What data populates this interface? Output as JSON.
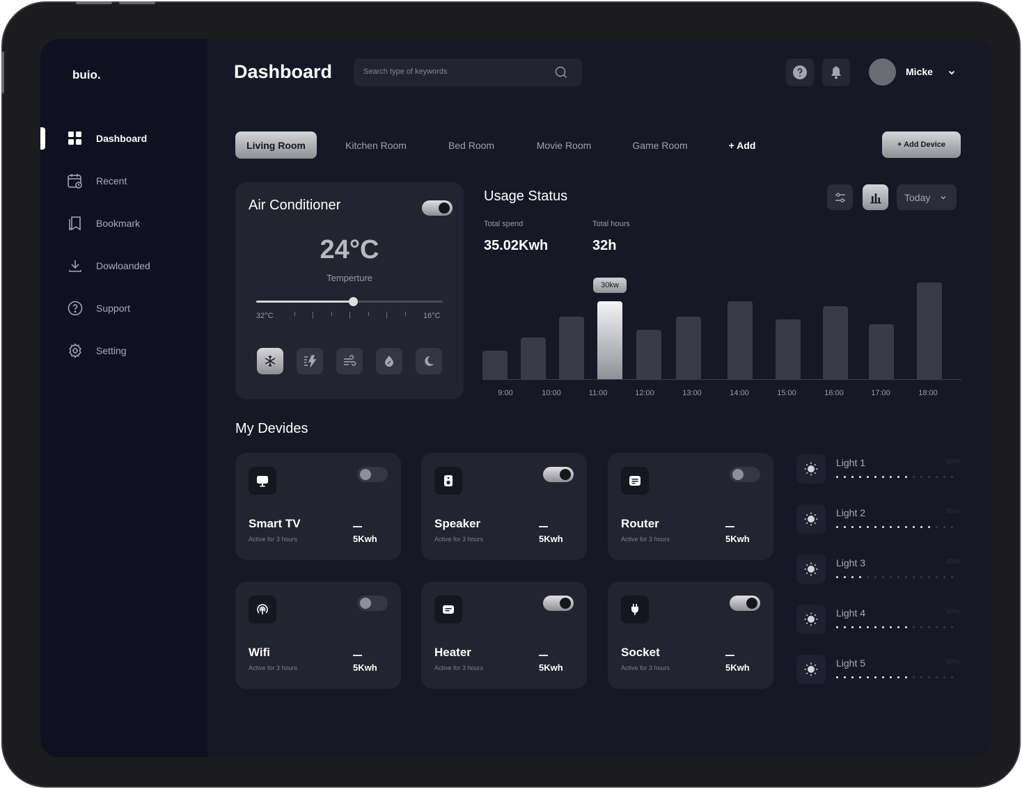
{
  "app": {
    "logo": "buio.",
    "page_title": "Dashboard"
  },
  "search": {
    "placeholder": "Search type of keywords"
  },
  "user": {
    "name": "Micke"
  },
  "sidebar": {
    "items": [
      {
        "label": "Dashboard",
        "icon": "dashboard-grid-icon",
        "active": true
      },
      {
        "label": "Recent",
        "icon": "calendar-clock-icon",
        "active": false
      },
      {
        "label": "Bookmark",
        "icon": "bookmark-icon",
        "active": false
      },
      {
        "label": "Dowloanded",
        "icon": "download-icon",
        "active": false
      },
      {
        "label": "Support",
        "icon": "help-circle-icon",
        "active": false
      },
      {
        "label": "Setting",
        "icon": "gear-icon",
        "active": false
      }
    ]
  },
  "rooms": {
    "tabs": [
      "Living Room",
      "Kitchen Room",
      "Bed Room",
      "Movie Room",
      "Game Room"
    ],
    "add_label": "+ Add",
    "active_index": 0
  },
  "add_device_label": "+ Add Device",
  "air_conditioner": {
    "title": "Air Conditioner",
    "power_on": true,
    "temperature": "24°C",
    "temperature_label": "Temperture",
    "scale_min": "32°C",
    "scale_max": "16°C",
    "slider_level": 0.52,
    "modes": [
      "snowflake-icon",
      "energy-bolt-icon",
      "wind-icon",
      "drop-icon",
      "moon-icon"
    ],
    "active_mode_index": 0
  },
  "usage": {
    "title": "Usage Status",
    "total_spend_label": "Total spend",
    "total_spend": "35.02Kwh",
    "total_hours_label": "Total hours",
    "total_hours": "32h",
    "period": "Today",
    "tooltip": "30kw"
  },
  "chart_data": {
    "type": "bar",
    "categories": [
      "9:00",
      "",
      "10:00",
      "",
      "11:00",
      "",
      "12:00",
      "",
      "13:00",
      "",
      "14:00",
      "",
      "15:00",
      "",
      "16:00",
      "",
      "17:00",
      "",
      "18:00"
    ],
    "x_tick_labels": [
      "9:00",
      "10:00",
      "11:00",
      "12:00",
      "13:00",
      "14:00",
      "15:00",
      "16:00",
      "17:00",
      "18:00"
    ],
    "values": [
      11,
      16,
      24,
      30,
      19,
      24,
      30,
      23,
      28,
      21,
      37
    ],
    "bar_labels_positions": [
      "9:00",
      "9:30",
      "10:00",
      "11:00",
      "12:00",
      "13:00",
      "14:00",
      "15:00",
      "16:00",
      "17:00",
      "18:00"
    ],
    "highlight_index": 3,
    "highlight_label": "30kw",
    "ylim": [
      0,
      40
    ],
    "xlabel": "",
    "ylabel": ""
  },
  "devices_title": "My Devides",
  "devices": [
    {
      "name": "Smart TV",
      "sub": "Active for 3 hours",
      "kwh": "5Kwh",
      "on": false,
      "icon": "tv-icon"
    },
    {
      "name": "Speaker",
      "sub": "Active for 3 hours",
      "kwh": "5Kwh",
      "on": true,
      "icon": "speaker-icon"
    },
    {
      "name": "Router",
      "sub": "Active for 3 hours",
      "kwh": "5Kwh",
      "on": false,
      "icon": "router-icon"
    },
    {
      "name": "Wifi",
      "sub": "Active for 3 hours",
      "kwh": "5Kwh",
      "on": false,
      "icon": "wifi-icon"
    },
    {
      "name": "Heater",
      "sub": "Active for 3 hours",
      "kwh": "5Kwh",
      "on": true,
      "icon": "heater-icon"
    },
    {
      "name": "Socket",
      "sub": "Active for 3 hours",
      "kwh": "5Kwh",
      "on": true,
      "icon": "plug-icon"
    }
  ],
  "lights": [
    {
      "name": "Light 1",
      "percent": "60%",
      "level": 0.6
    },
    {
      "name": "Light 2",
      "percent": "80%",
      "level": 0.8
    },
    {
      "name": "Light 3",
      "percent": "45%",
      "level": 0.28
    },
    {
      "name": "Light 4",
      "percent": "60%",
      "level": 0.6
    },
    {
      "name": "Light 5",
      "percent": "60%",
      "level": 0.6
    }
  ],
  "colors": {
    "background": "#161826",
    "sidebar": "#0f1120",
    "card": "#23242f",
    "accent": "#d6d6d9",
    "bar": "#393a45"
  }
}
